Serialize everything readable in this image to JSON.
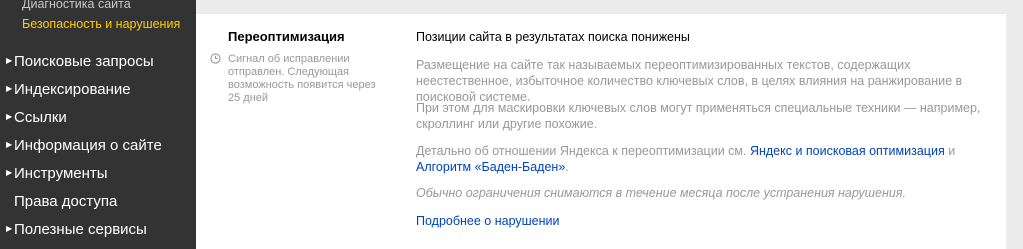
{
  "sidebar": {
    "sub_items": {
      "diagnostics": "Диагностика сайта",
      "security": "Безопасность и нарушения"
    },
    "items": [
      {
        "label": "Поисковые запросы",
        "arrow": "▶"
      },
      {
        "label": "Индексирование",
        "arrow": "▶"
      },
      {
        "label": "Ссылки",
        "arrow": "▶"
      },
      {
        "label": "Информация о сайте",
        "arrow": "▶"
      },
      {
        "label": "Инструменты",
        "arrow": "▶"
      },
      {
        "label": "Права доступа"
      },
      {
        "label": "Полезные сервисы",
        "arrow": "▶"
      }
    ]
  },
  "issue": {
    "title": "Переоптимизация",
    "icon": "clock-icon",
    "signal_text": "Сигнал об исправлении отправлен. Следующая возможность появится через 25 дней",
    "headline": "Позиции сайта в результатах поиска понижены",
    "paragraph1": "Размещение на сайте так называемых переоптимизированных текстов, содержащих неестественное, избыточное количество ключевых слов, в целях влияния на ранжирование в поисковой системе.",
    "paragraph2": "При этом для маскировки ключевых слов могут применяться специальные техники — например, скроллинг или другие похожие.",
    "paragraph3_prefix": "Детально об отношении Яндекса к переоптимизации см. ",
    "link1": "Яндекс и поисковая оптимизация",
    "paragraph3_middle": " и ",
    "link2": "Алгоритм «Баден-Баден»",
    "paragraph3_suffix": ".",
    "note": "Обычно ограничения снимаются в течение месяца после устранения нарушения.",
    "more_link": "Подробнее о нарушении"
  },
  "colors": {
    "sidebar_bg": "#333333",
    "active_item": "#ffcc00",
    "link": "#0044bb",
    "muted_text": "#999999"
  }
}
